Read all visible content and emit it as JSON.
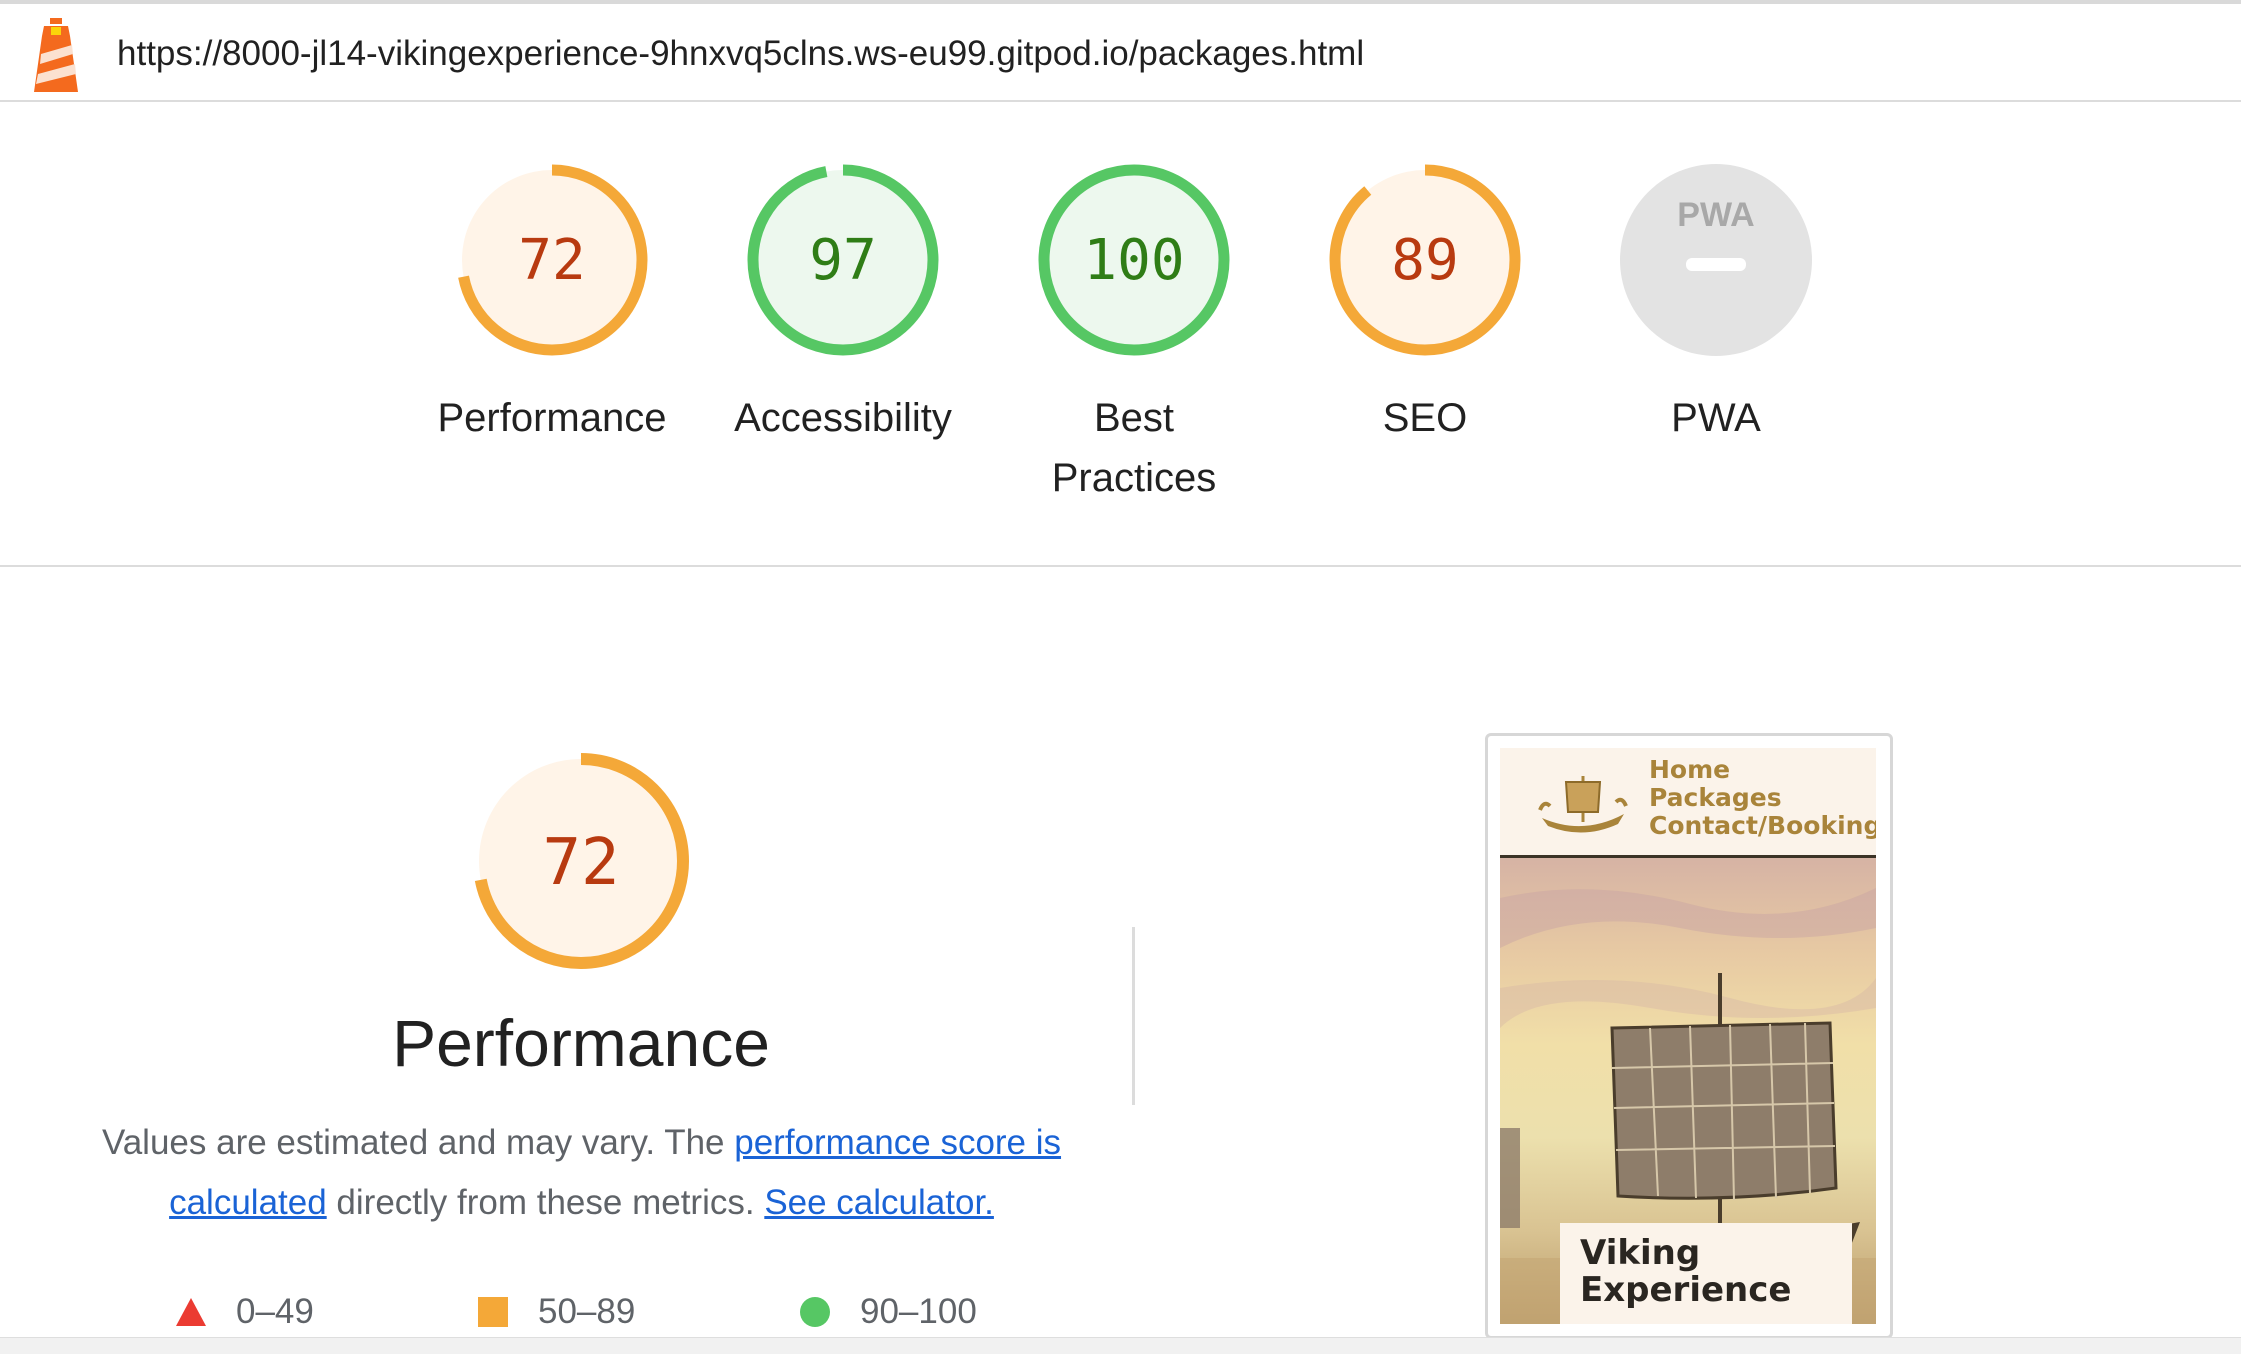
{
  "url_bar": {
    "icon": "lighthouse-icon",
    "url": "https://8000-jl14-vikingexperience-9hnxvq5clns.ws-eu99.gitpod.io/packages.html"
  },
  "gauges": [
    {
      "label": "Performance",
      "score": "72",
      "value": 72,
      "status": "average"
    },
    {
      "label": "Accessibility",
      "score": "97",
      "value": 97,
      "status": "pass"
    },
    {
      "label": "Best Practices",
      "score": "100",
      "value": 100,
      "status": "pass"
    },
    {
      "label": "SEO",
      "score": "89",
      "value": 89,
      "status": "average"
    },
    {
      "label": "PWA",
      "score": "",
      "value": null,
      "status": "na",
      "badge": "PWA"
    }
  ],
  "performance": {
    "score": "72",
    "value": 72,
    "title": "Performance",
    "desc_prefix": "Values are estimated and may vary. The ",
    "link_score": "performance score is calculated",
    "desc_middle": " directly from these metrics. ",
    "link_calculator": "See calculator."
  },
  "legend": [
    {
      "shape": "triangle",
      "range": "0–49",
      "color": "#eb3b32"
    },
    {
      "shape": "square",
      "range": "50–89",
      "color": "#f4a838"
    },
    {
      "shape": "circle",
      "range": "90–100",
      "color": "#56c764"
    }
  ],
  "screenshot": {
    "nav": [
      "Home",
      "Packages",
      "Contact/Booking"
    ],
    "card_title": "Viking Experience"
  },
  "colors": {
    "average_stroke": "#f4a838",
    "average_fill": "#fff4e8",
    "average_text": "#b83a10",
    "pass_stroke": "#56c764",
    "pass_fill": "#edf8ee",
    "pass_text": "#2f7d16",
    "na_fill": "#e3e3e3",
    "link": "#1a63d6"
  }
}
